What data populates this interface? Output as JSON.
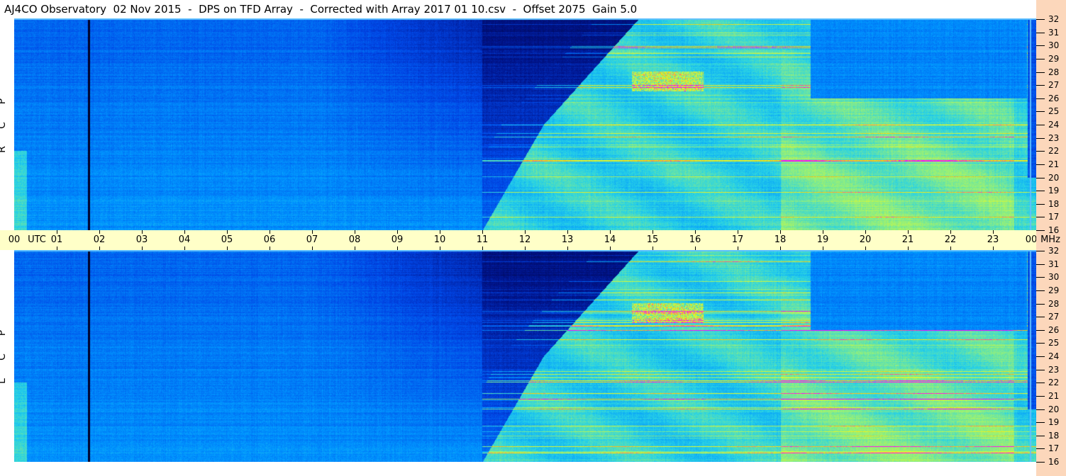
{
  "title": "AJ4CO Observatory  02 Nov 2015  -  DPS on TFD Array  -  Corrected with Array 2017 01 10.csv  -  Offset 2075  Gain 5.0",
  "channels": {
    "top": [
      "R",
      "C",
      "P"
    ],
    "bottom": [
      "L",
      "C",
      "P"
    ]
  },
  "time_axis": {
    "labels": [
      "00",
      "01",
      "02",
      "03",
      "04",
      "05",
      "06",
      "07",
      "08",
      "09",
      "10",
      "11",
      "12",
      "13",
      "14",
      "15",
      "16",
      "17",
      "18",
      "19",
      "20",
      "21",
      "22",
      "23",
      "00"
    ],
    "unit": "UTC",
    "freq_unit": "MHz"
  },
  "freq_axis": {
    "labels": [
      "32",
      "31",
      "30",
      "29",
      "28",
      "27",
      "26",
      "25",
      "24",
      "23",
      "22",
      "21",
      "20",
      "19",
      "18",
      "17",
      "16"
    ]
  },
  "chart_data": {
    "type": "heatmap",
    "title": "AJ4CO Observatory 02 Nov 2015 - DPS on TFD Array",
    "xlabel": "UTC",
    "ylabel": "MHz",
    "xlim": [
      0,
      24
    ],
    "ylim": [
      16,
      32
    ],
    "series": [
      {
        "name": "RCP"
      },
      {
        "name": "LCP"
      }
    ]
  }
}
